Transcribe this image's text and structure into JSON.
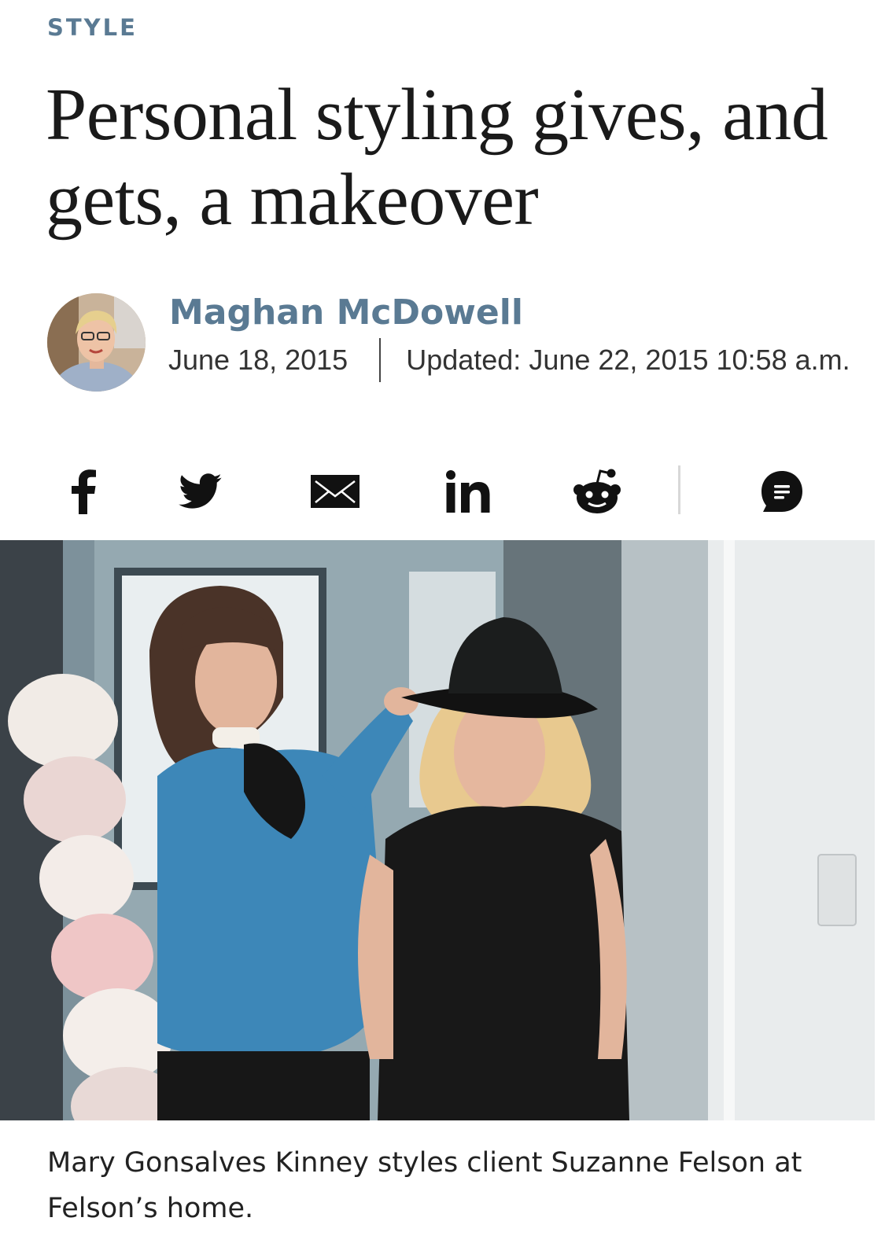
{
  "section": {
    "label": "STYLE"
  },
  "article": {
    "headline": "Personal styling gives, and gets, a makeover",
    "author": {
      "name": "Maghan McDowell",
      "avatar_alt": "author-photo"
    },
    "published": "June 18, 2015",
    "updated": "Updated: June 22, 2015 10:58 a.m.",
    "caption": "Mary Gonsalves Kinney styles client Suzanne Felson at Felson’s home."
  },
  "share": {
    "items": [
      {
        "name": "facebook",
        "icon": "facebook-icon"
      },
      {
        "name": "twitter",
        "icon": "twitter-icon"
      },
      {
        "name": "email",
        "icon": "email-icon"
      },
      {
        "name": "linkedin",
        "icon": "linkedin-icon"
      },
      {
        "name": "reddit",
        "icon": "reddit-icon"
      },
      {
        "name": "comments",
        "icon": "comment-icon"
      }
    ]
  },
  "colors": {
    "accent": "#5a7a93",
    "text": "#1a1a1a",
    "icon": "#111111",
    "divider": "#d8d8d8"
  }
}
